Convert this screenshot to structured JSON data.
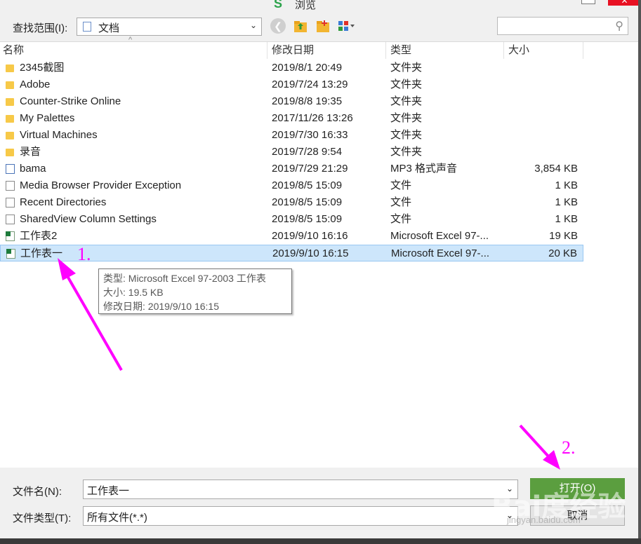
{
  "window": {
    "title": "浏览",
    "close_glyph": "✕"
  },
  "toolbar": {
    "look_in_label": "查找范围(I):",
    "look_in_value": "文档",
    "back_glyph": "❮",
    "search_glyph": "⚲"
  },
  "columns": {
    "name": "名称",
    "date": "修改日期",
    "type": "类型",
    "size": "大小"
  },
  "files": [
    {
      "icon": "folder",
      "name": "2345截图",
      "date": "2019/8/1 20:49",
      "type": "文件夹",
      "size": ""
    },
    {
      "icon": "folder",
      "name": "Adobe",
      "date": "2019/7/24 13:29",
      "type": "文件夹",
      "size": ""
    },
    {
      "icon": "folder",
      "name": "Counter-Strike Online",
      "date": "2019/8/8 19:35",
      "type": "文件夹",
      "size": ""
    },
    {
      "icon": "folder",
      "name": "My Palettes",
      "date": "2017/11/26 13:26",
      "type": "文件夹",
      "size": ""
    },
    {
      "icon": "folder",
      "name": "Virtual Machines",
      "date": "2019/7/30 16:33",
      "type": "文件夹",
      "size": ""
    },
    {
      "icon": "folder",
      "name": "录音",
      "date": "2019/7/28 9:54",
      "type": "文件夹",
      "size": ""
    },
    {
      "icon": "mp3",
      "name": "bama",
      "date": "2019/7/29 21:29",
      "type": "MP3 格式声音",
      "size": "3,854 KB"
    },
    {
      "icon": "file",
      "name": "Media Browser Provider Exception",
      "date": "2019/8/5 15:09",
      "type": "文件",
      "size": "1 KB"
    },
    {
      "icon": "file",
      "name": "Recent Directories",
      "date": "2019/8/5 15:09",
      "type": "文件",
      "size": "1 KB"
    },
    {
      "icon": "file",
      "name": "SharedView Column Settings",
      "date": "2019/8/5 15:09",
      "type": "文件",
      "size": "1 KB"
    },
    {
      "icon": "excel",
      "name": "工作表2",
      "date": "2019/9/10 16:16",
      "type": "Microsoft Excel 97-...",
      "size": "19 KB"
    },
    {
      "icon": "excel",
      "name": "工作表一",
      "date": "2019/9/10 16:15",
      "type": "Microsoft Excel 97-...",
      "size": "20 KB",
      "selected": true
    }
  ],
  "tooltip": {
    "type_line": "类型: Microsoft Excel 97-2003 工作表",
    "size_line": "大小: 19.5 KB",
    "date_line": "修改日期: 2019/9/10 16:15"
  },
  "annotations": {
    "step1": "1.",
    "step2": "2.",
    "color": "#ff00ff"
  },
  "bottom": {
    "filename_label": "文件名(N):",
    "filename_value": "工作表一",
    "filetype_label": "文件类型(T):",
    "filetype_value": "所有文件(*.*)",
    "open_button": "打开(O)",
    "cancel_button": "取消"
  },
  "watermark": {
    "logo": "Bai度经验",
    "url": "jingyan.baidu.com"
  },
  "colors": {
    "selection": "#cde6fb",
    "open_button": "#5b9e3f",
    "folder": "#f7c948",
    "excel": "#1e7b3c"
  }
}
